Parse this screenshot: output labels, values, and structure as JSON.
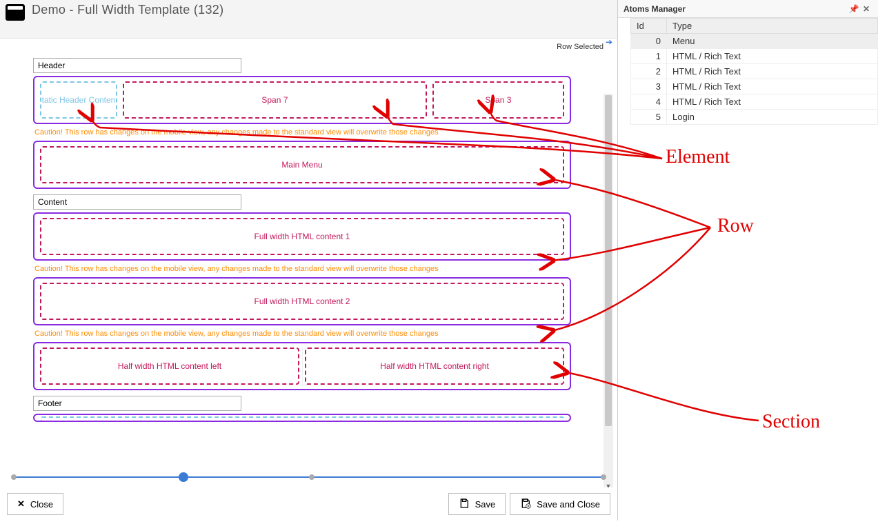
{
  "title": "Demo - Full Width Template (132)",
  "status_text": "Row Selected",
  "sections": {
    "header_label": "Header",
    "content_label": "Content",
    "footer_label": "Footer"
  },
  "elements": {
    "static_header": "tatic Header Conten",
    "span7": "Span 7",
    "span3": "Span 3",
    "main_menu": "Main Menu",
    "full1": "Full width HTML content 1",
    "full2": "Full width HTML content 2",
    "half_left": "Half width HTML content left",
    "half_right": "Half width HTML content right"
  },
  "caution": "Caution! This row has changes on the mobile view, any changes made to the standard view will overwrite those changes",
  "buttons": {
    "close": "Close",
    "save": "Save",
    "save_close": "Save and Close"
  },
  "panel": {
    "title": "Atoms Manager",
    "col_id": "Id",
    "col_type": "Type",
    "rows": [
      {
        "id": "0",
        "type": "Menu"
      },
      {
        "id": "1",
        "type": "HTML / Rich Text"
      },
      {
        "id": "2",
        "type": "HTML / Rich Text"
      },
      {
        "id": "3",
        "type": "HTML / Rich Text"
      },
      {
        "id": "4",
        "type": "HTML / Rich Text"
      },
      {
        "id": "5",
        "type": "Login"
      }
    ]
  },
  "annotations": {
    "element": "Element",
    "row": "Row",
    "section": "Section"
  }
}
